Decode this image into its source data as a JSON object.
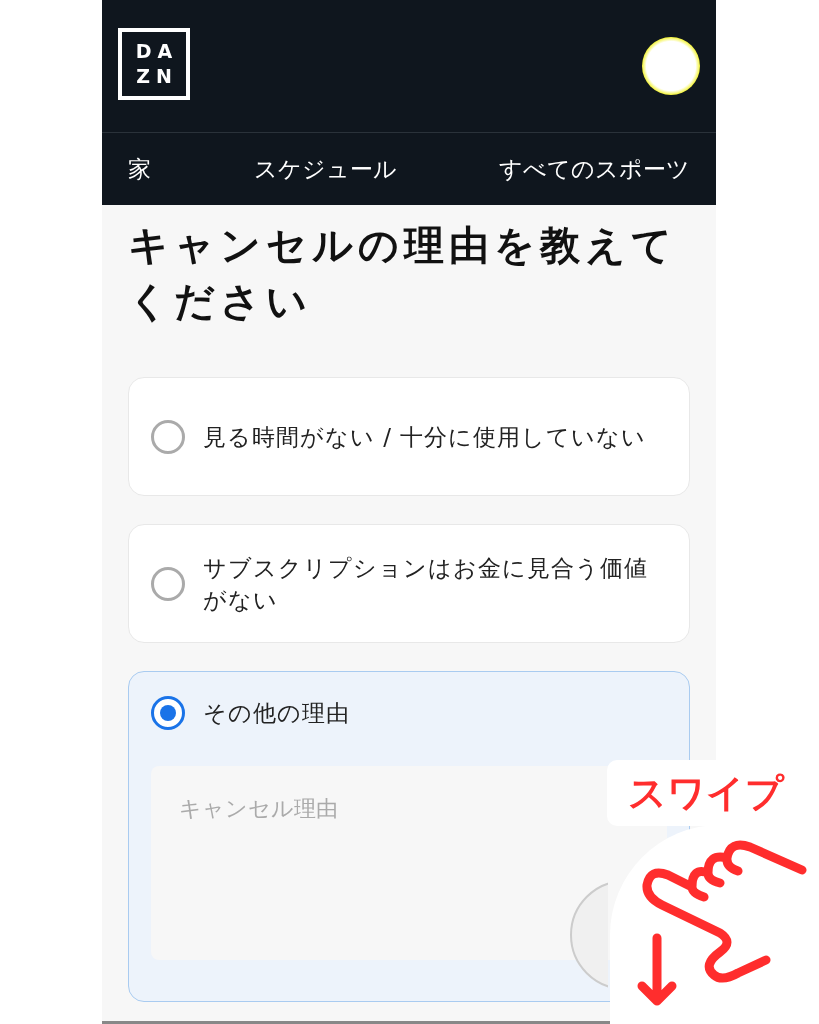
{
  "header": {
    "logo_lines": [
      "DA",
      "ZN"
    ]
  },
  "nav": [
    {
      "label": "家"
    },
    {
      "label": "スケジュール"
    },
    {
      "label": "すべてのスポーツ"
    }
  ],
  "title": "キャンセルの理由を教えてください",
  "options": [
    {
      "label": "見る時間がない / 十分に使用していない",
      "selected": false
    },
    {
      "label": "サブスクリプションはお金に見合う価値がない",
      "selected": false
    },
    {
      "label": "その他の理由",
      "selected": true,
      "field": {
        "placeholder": "キャンセル理由"
      }
    }
  ],
  "swipe_hint": {
    "label": "スワイプ"
  }
}
